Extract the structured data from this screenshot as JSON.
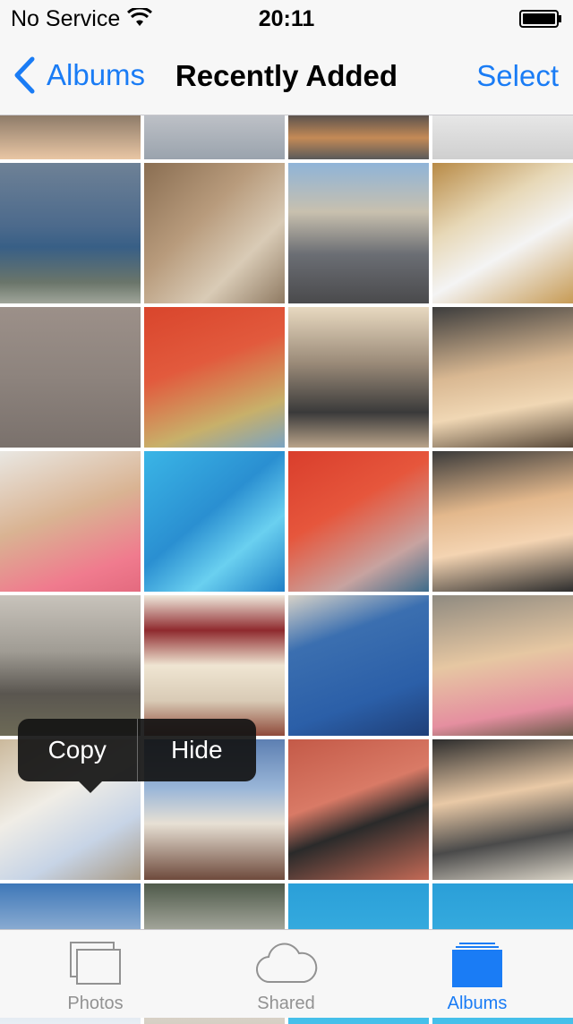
{
  "status_bar": {
    "carrier": "No Service",
    "time": "20:11",
    "wifi_icon": "wifi-icon",
    "battery_icon": "battery-icon"
  },
  "nav": {
    "back_label": "Albums",
    "title": "Recently Added",
    "select_label": "Select"
  },
  "context_menu": {
    "copy_label": "Copy",
    "hide_label": "Hide"
  },
  "tabs": [
    {
      "label": "Photos",
      "icon": "photos-icon",
      "selected": false
    },
    {
      "label": "Shared",
      "icon": "cloud-icon",
      "selected": false
    },
    {
      "label": "Albums",
      "icon": "albums-icon",
      "selected": true
    }
  ],
  "colors": {
    "accent": "#1a7cf5",
    "tab_inactive": "#929292",
    "bar_background": "#f7f7f7"
  }
}
